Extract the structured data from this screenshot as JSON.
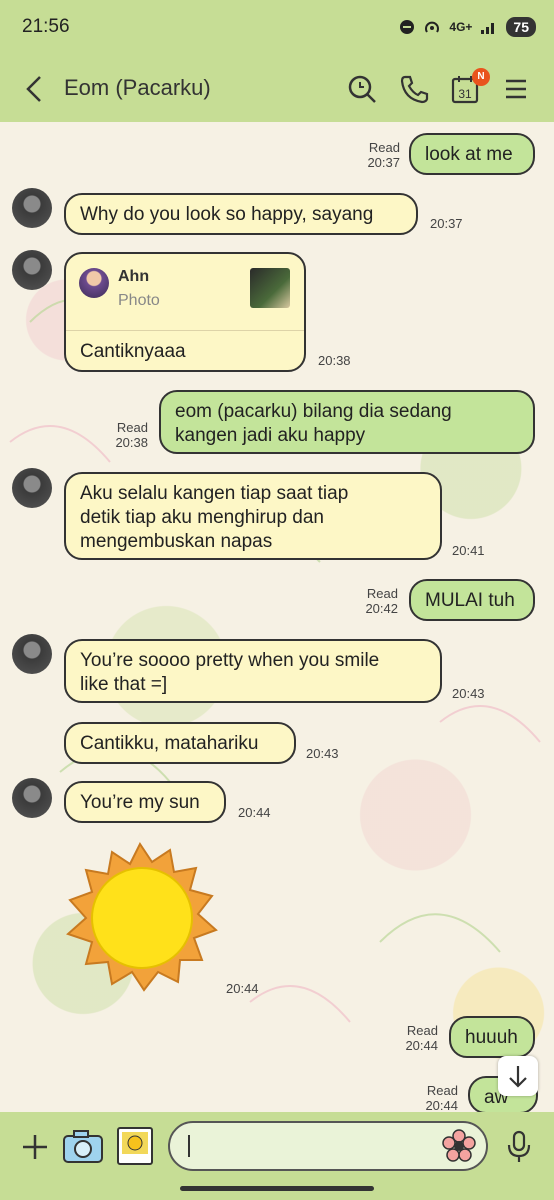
{
  "status": {
    "time": "21:56",
    "network": "4G+",
    "battery": "75"
  },
  "header": {
    "title": "Eom (Pacarku)",
    "calendar_day": "31",
    "calendar_badge": "N"
  },
  "messages": [
    {
      "dir": "out",
      "text": "look at me",
      "status": "Read",
      "time": "20:37"
    },
    {
      "dir": "in",
      "text": "Why do you look so happy, sayang",
      "time": "20:37"
    },
    {
      "dir": "in",
      "quote_name": "Ahn",
      "quote_type": "Photo",
      "text": "Cantiknyaaa",
      "time": "20:38"
    },
    {
      "dir": "out",
      "line1": "eom (pacarku) bilang dia sedang",
      "line2": "kangen jadi aku happy",
      "status": "Read",
      "time": "20:38"
    },
    {
      "dir": "in",
      "line1": "Aku selalu kangen tiap saat tiap",
      "line2": "detik tiap aku menghirup dan",
      "line3": "mengembuskan napas",
      "time": "20:41"
    },
    {
      "dir": "out",
      "text": "MULAI tuh",
      "status": "Read",
      "time": "20:42"
    },
    {
      "dir": "in",
      "line1": "You’re soooo pretty when you smile",
      "line2": "like that =]",
      "time": "20:43"
    },
    {
      "dir": "in",
      "text": "Cantikku, matahariku",
      "time": "20:43"
    },
    {
      "dir": "in",
      "text": "You’re my sun",
      "time": "20:44"
    },
    {
      "dir": "in",
      "sticker": "sun-sticker",
      "time": "20:44"
    },
    {
      "dir": "out",
      "text": "huuuh",
      "status": "Read",
      "time": "20:44"
    },
    {
      "dir": "out",
      "text": "aw",
      "status": "Read",
      "time": "20:44"
    }
  ],
  "colors": {
    "header": "#c6dd95",
    "incoming": "#fdf7c6",
    "outgoing": "#c3e49a"
  }
}
